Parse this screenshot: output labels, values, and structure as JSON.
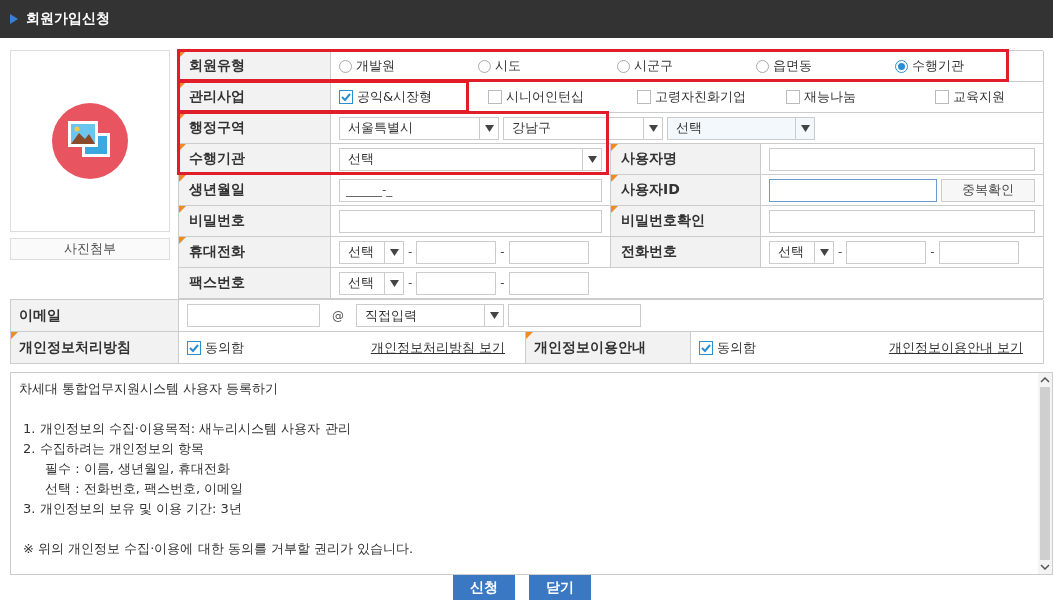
{
  "title": "회원가입신청",
  "photo": {
    "button": "사진첨부"
  },
  "member_type": {
    "label": "회원유형",
    "required": true,
    "options": [
      {
        "label": "개발원",
        "selected": false
      },
      {
        "label": "시도",
        "selected": false
      },
      {
        "label": "시군구",
        "selected": false
      },
      {
        "label": "읍면동",
        "selected": false
      },
      {
        "label": "수행기관",
        "selected": true
      }
    ]
  },
  "business": {
    "label": "관리사업",
    "required": true,
    "options": [
      {
        "label": "공익&시장형",
        "checked": true
      },
      {
        "label": "시니어인턴십",
        "checked": false
      },
      {
        "label": "고령자친화기업",
        "checked": false
      },
      {
        "label": "재능나눔",
        "checked": false
      },
      {
        "label": "교육지원",
        "checked": false
      }
    ]
  },
  "region": {
    "label": "행정구역",
    "required": true,
    "selects": [
      "서울특별시",
      "강남구",
      "선택"
    ]
  },
  "agency": {
    "label": "수행기관",
    "required": true,
    "value": "선택"
  },
  "user_name": {
    "label": "사용자명",
    "required": true
  },
  "birth_date": {
    "label": "생년월일",
    "required": true,
    "value": "______-_"
  },
  "user_id": {
    "label": "사용자ID",
    "required": true,
    "focused": true,
    "button": "중복확인"
  },
  "password": {
    "label": "비밀번호",
    "required": true
  },
  "password_confirm": {
    "label": "비밀번호확인",
    "required": true
  },
  "mobile": {
    "label": "휴대전화",
    "required": true,
    "prefix": "선택",
    "separators": [
      "-",
      "-"
    ]
  },
  "phone": {
    "label": "전화번호",
    "required": false,
    "prefix": "선택",
    "separators": [
      "-",
      "-"
    ]
  },
  "fax": {
    "label": "팩스번호",
    "required": false,
    "prefix": "선택",
    "separators": [
      "-",
      "-"
    ]
  },
  "email": {
    "label": "이메일",
    "required": false,
    "at": "@",
    "domain": "직접입력"
  },
  "privacy_policy": {
    "label": "개인정보처리방침",
    "required": true,
    "agree": {
      "label": "동의함",
      "checked": true
    },
    "link": "개인정보처리방침 보기"
  },
  "privacy_usage": {
    "label": "개인정보이용안내",
    "required": true,
    "agree": {
      "label": "동의함",
      "checked": true
    },
    "link": "개인정보이용안내 보기"
  },
  "terms": [
    {
      "kind": "title",
      "text": "차세대 통합업무지원시스템 사용자 등록하기"
    },
    {
      "kind": "item",
      "text": "1. 개인정보의 수집·이용목적: 새누리시스템 사용자 관리"
    },
    {
      "kind": "item",
      "text": "2. 수집하려는 개인정보의 항목"
    },
    {
      "kind": "sub",
      "text": "필수 : 이름, 생년월일, 휴대전화"
    },
    {
      "kind": "sub",
      "text": "선택 : 전화번호, 팩스번호, 이메일"
    },
    {
      "kind": "item",
      "text": "3. 개인정보의 보유 및 이용 기간: 3년"
    },
    {
      "kind": "note",
      "text": "※ 위의 개인정보 수집·이용에 대한 동의를 거부할 권리가 있습니다."
    }
  ],
  "buttons": [
    {
      "label": "신청"
    },
    {
      "label": "닫기"
    }
  ]
}
